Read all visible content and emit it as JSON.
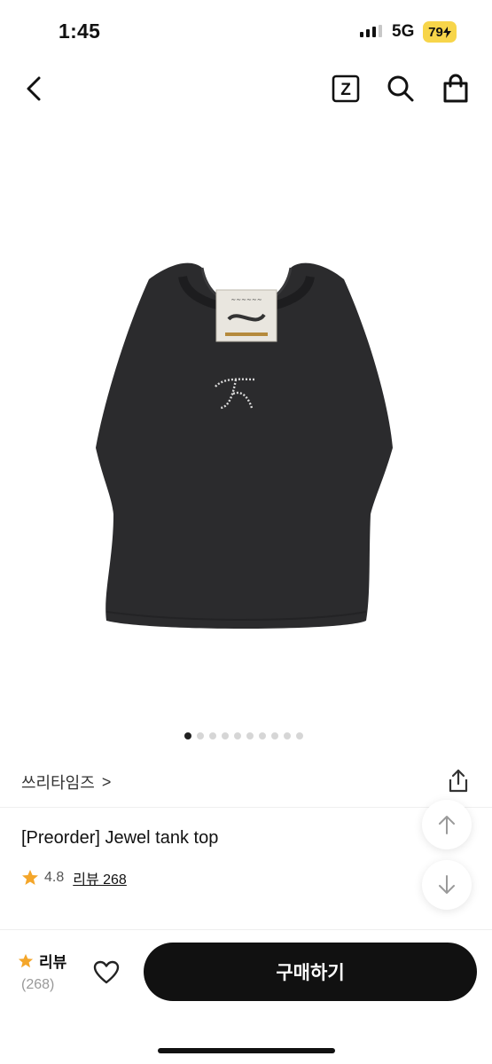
{
  "status_bar": {
    "time": "1:45",
    "network": "5G",
    "battery": "79"
  },
  "nav": {
    "back_icon": "chevron-left-icon",
    "z_icon_label": "Z",
    "search_icon": "search-icon",
    "cart_icon": "shopping-bag-icon"
  },
  "carousel": {
    "total": 10,
    "active_index": 0
  },
  "product": {
    "brand": "쓰리타임즈",
    "brand_chevron": ">",
    "title": "[Preorder] Jewel tank top",
    "rating": "4.8",
    "review_link": "리뷰 268"
  },
  "bottom_bar": {
    "review_label": "리뷰",
    "review_count": "(268)",
    "buy_label": "구매하기"
  },
  "colors": {
    "accent_star": "#f4a62a",
    "button_bg": "#111111"
  }
}
